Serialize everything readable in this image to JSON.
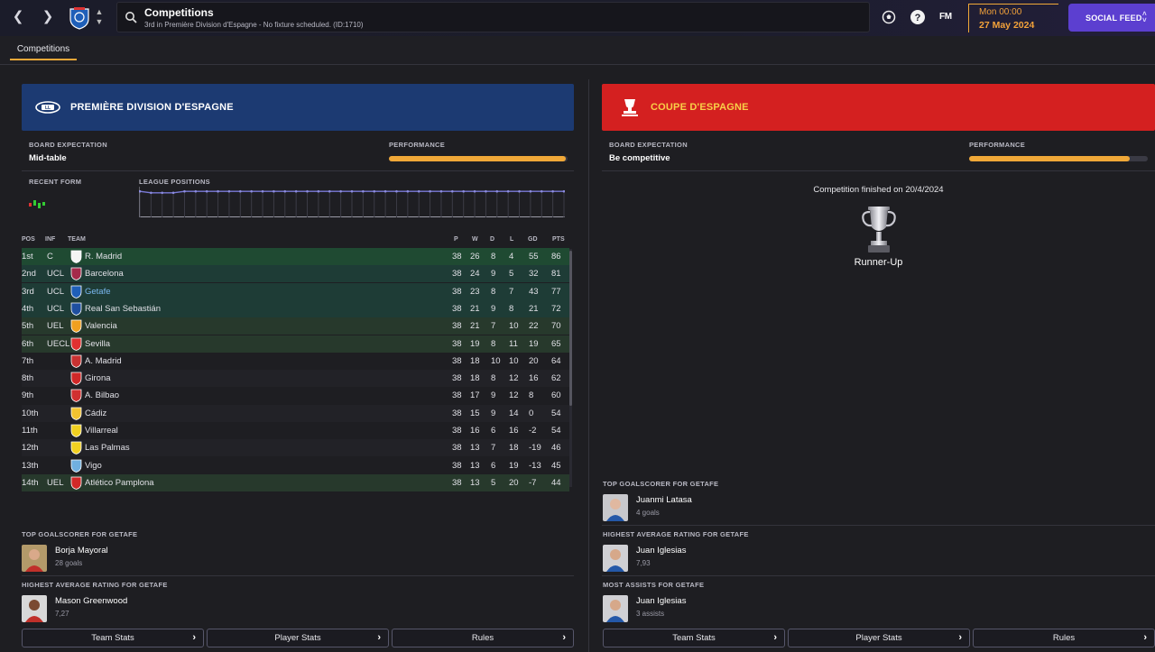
{
  "topbar": {
    "back_icon": "chevron-left-icon",
    "forward_icon": "chevron-right-icon",
    "search": {
      "title": "Competitions",
      "subtitle": "3rd in Première Division d'Espagne - No fixture scheduled. (ID:1710)"
    },
    "fm_label": "FM",
    "date": {
      "time": "Mon 00:00",
      "day": "27 May 2024"
    },
    "social_feed_label": "SOCIAL FEED"
  },
  "tabs": [
    {
      "label": "Competitions"
    }
  ],
  "league": {
    "name": "PREMIÈRE DIVISION D'ESPAGNE",
    "header_color": "#1c3a72",
    "board_expectation_label": "BOARD EXPECTATION",
    "board_expectation": "Mid-table",
    "performance_label": "PERFORMANCE",
    "performance": 0.99,
    "recent_form_label": "RECENT FORM",
    "league_positions_label": "LEAGUE POSITIONS",
    "positions_history": [
      3,
      4,
      4,
      4,
      3,
      3,
      3,
      3,
      3,
      3,
      3,
      3,
      3,
      3,
      3,
      3,
      3,
      3,
      3,
      3,
      3,
      3,
      3,
      3,
      3,
      3,
      3,
      3,
      3,
      3,
      3,
      3,
      3,
      3,
      3,
      3,
      3,
      3,
      3
    ],
    "table_headers": {
      "pos": "POS",
      "inf": "INF",
      "team": "TEAM",
      "p": "P",
      "w": "W",
      "d": "D",
      "l": "L",
      "gd": "GD",
      "pts": "PTS"
    },
    "rows": [
      {
        "pos": "1st",
        "inf": "C",
        "team": "R. Madrid",
        "p": "38",
        "w": "26",
        "d": "8",
        "l": "4",
        "gd": "55",
        "pts": "86"
      },
      {
        "pos": "2nd",
        "inf": "UCL",
        "team": "Barcelona",
        "p": "38",
        "w": "24",
        "d": "9",
        "l": "5",
        "gd": "32",
        "pts": "81"
      },
      {
        "pos": "3rd",
        "inf": "UCL",
        "team": "Getafe",
        "p": "38",
        "w": "23",
        "d": "8",
        "l": "7",
        "gd": "43",
        "pts": "77"
      },
      {
        "pos": "4th",
        "inf": "UCL",
        "team": "Real San Sebastián",
        "p": "38",
        "w": "21",
        "d": "9",
        "l": "8",
        "gd": "21",
        "pts": "72"
      },
      {
        "pos": "5th",
        "inf": "UEL",
        "team": "Valencia",
        "p": "38",
        "w": "21",
        "d": "7",
        "l": "10",
        "gd": "22",
        "pts": "70"
      },
      {
        "pos": "6th",
        "inf": "UECL",
        "team": "Sevilla",
        "p": "38",
        "w": "19",
        "d": "8",
        "l": "11",
        "gd": "19",
        "pts": "65"
      },
      {
        "pos": "7th",
        "inf": "",
        "team": "A. Madrid",
        "p": "38",
        "w": "18",
        "d": "10",
        "l": "10",
        "gd": "20",
        "pts": "64"
      },
      {
        "pos": "8th",
        "inf": "",
        "team": "Girona",
        "p": "38",
        "w": "18",
        "d": "8",
        "l": "12",
        "gd": "16",
        "pts": "62"
      },
      {
        "pos": "9th",
        "inf": "",
        "team": "A. Bilbao",
        "p": "38",
        "w": "17",
        "d": "9",
        "l": "12",
        "gd": "8",
        "pts": "60"
      },
      {
        "pos": "10th",
        "inf": "",
        "team": "Cádiz",
        "p": "38",
        "w": "15",
        "d": "9",
        "l": "14",
        "gd": "0",
        "pts": "54"
      },
      {
        "pos": "11th",
        "inf": "",
        "team": "Villarreal",
        "p": "38",
        "w": "16",
        "d": "6",
        "l": "16",
        "gd": "-2",
        "pts": "54"
      },
      {
        "pos": "12th",
        "inf": "",
        "team": "Las Palmas",
        "p": "38",
        "w": "13",
        "d": "7",
        "l": "18",
        "gd": "-19",
        "pts": "46"
      },
      {
        "pos": "13th",
        "inf": "",
        "team": "Vigo",
        "p": "38",
        "w": "13",
        "d": "6",
        "l": "19",
        "gd": "-13",
        "pts": "45"
      },
      {
        "pos": "14th",
        "inf": "UEL",
        "team": "Atlético Pamplona",
        "p": "38",
        "w": "13",
        "d": "5",
        "l": "20",
        "gd": "-7",
        "pts": "44"
      }
    ],
    "top_goalscorer_label": "TOP GOALSCORER FOR GETAFE",
    "top_goalscorer": {
      "name": "Borja Mayoral",
      "detail": "28 goals"
    },
    "highest_rating_label": "HIGHEST AVERAGE RATING FOR GETAFE",
    "highest_rating": {
      "name": "Mason Greenwood",
      "detail": "7,27"
    },
    "buttons": [
      "Team Stats",
      "Player Stats",
      "Rules"
    ]
  },
  "cup": {
    "name": "COUPE D'ESPAGNE",
    "header_color": "#d42020",
    "name_color": "#f8d048",
    "board_expectation_label": "BOARD EXPECTATION",
    "board_expectation": "Be competitive",
    "performance_label": "PERFORMANCE",
    "performance": 0.9,
    "finished_text": "Competition finished on 20/4/2024",
    "result": "Runner-Up",
    "top_goalscorer_label": "TOP GOALSCORER FOR GETAFE",
    "top_goalscorer": {
      "name": "Juanmi Latasa",
      "detail": "4 goals"
    },
    "highest_rating_label": "HIGHEST AVERAGE RATING FOR GETAFE",
    "highest_rating": {
      "name": "Juan Iglesias",
      "detail": "7,93"
    },
    "most_assists_label": "MOST ASSISTS FOR GETAFE",
    "most_assists": {
      "name": "Juan Iglesias",
      "detail": "3 assists"
    },
    "buttons": [
      "Team Stats",
      "Player Stats",
      "Rules"
    ]
  }
}
